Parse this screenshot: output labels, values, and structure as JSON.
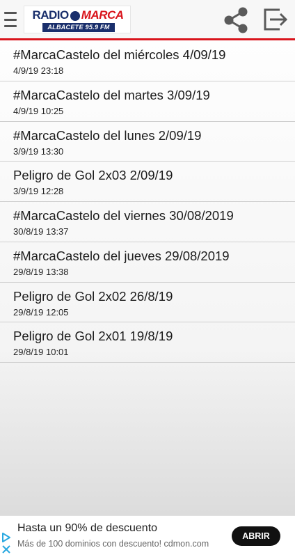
{
  "header": {
    "logo": {
      "top_left": "RADIO",
      "top_right": "MARCA",
      "bottom": "ALBACETE 95.9 FM"
    }
  },
  "list": {
    "items": [
      {
        "title": "#MarcaCastelo del miércoles 4/09/19",
        "date": "4/9/19 23:18"
      },
      {
        "title": "#MarcaCastelo del martes 3/09/19",
        "date": "4/9/19 10:25"
      },
      {
        "title": "#MarcaCastelo del lunes 2/09/19",
        "date": "3/9/19 13:30"
      },
      {
        "title": "Peligro de Gol 2x03 2/09/19",
        "date": "3/9/19 12:28"
      },
      {
        "title": "#MarcaCastelo del viernes 30/08/2019",
        "date": "30/8/19 13:37"
      },
      {
        "title": "#MarcaCastelo del jueves 29/08/2019",
        "date": "29/8/19 13:38"
      },
      {
        "title": "Peligro de Gol 2x02 26/8/19",
        "date": "29/8/19 12:05"
      },
      {
        "title": "Peligro de Gol 2x01 19/8/19",
        "date": "29/8/19 10:01"
      }
    ]
  },
  "ad": {
    "title": "Hasta un 90% de descuento",
    "subtitle": "Más de 100 dominios con descuento! cdmon.com",
    "button_label": "ABRIR"
  },
  "colors": {
    "accent": "#d9141c",
    "brand_blue": "#1a2f6c",
    "icon_gray": "#555555"
  },
  "icons": [
    "menu-icon",
    "share-icon",
    "exit-icon",
    "adchoices-icon",
    "close-icon"
  ]
}
